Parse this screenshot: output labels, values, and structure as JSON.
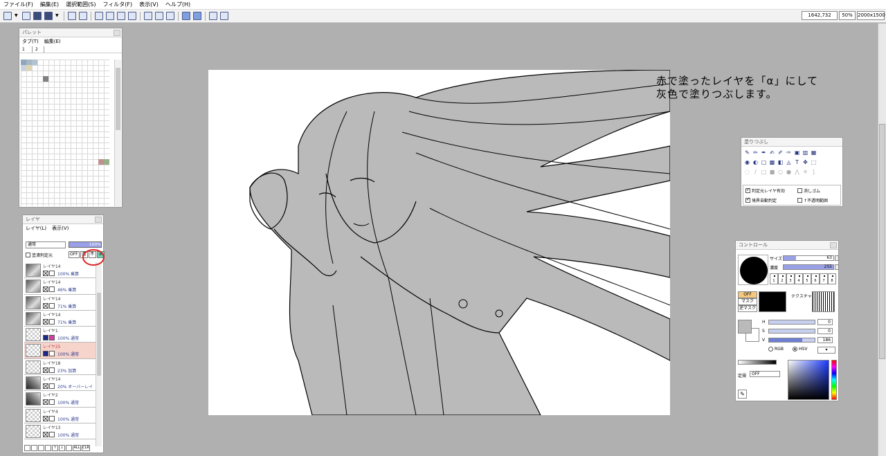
{
  "menu": [
    "ファイル(F)",
    "編集(E)",
    "選択範囲(S)",
    "フィルタ(F)",
    "表示(V)",
    "ヘルプ(H)"
  ],
  "toolbar": {
    "coords": "1642,732",
    "zoom": "50%",
    "canvas_size": "2000x1500"
  },
  "palette": {
    "title": "パレット",
    "menu": [
      "タブ(T)",
      "編集(E)"
    ],
    "tabs": [
      "1",
      "2"
    ],
    "swatches": [
      {
        "col": 0,
        "row": 0,
        "color": "#8fa6bf"
      },
      {
        "col": 1,
        "row": 0,
        "color": "#a7b8c4"
      },
      {
        "col": 2,
        "row": 0,
        "color": "#b3c2cc"
      },
      {
        "col": 0,
        "row": 1,
        "color": "#c9d3dc"
      },
      {
        "col": 1,
        "row": 1,
        "color": "#e0d5b3"
      },
      {
        "col": 4,
        "row": 3,
        "color": "#808080"
      },
      {
        "col": 14,
        "row": 18,
        "color": "#c09090"
      },
      {
        "col": 15,
        "row": 18,
        "color": "#98b08a"
      }
    ]
  },
  "layer": {
    "title": "レイヤ",
    "menu": [
      "レイヤ(L)",
      "表示(V)"
    ],
    "blend": "通常",
    "opacity": "100%",
    "clip_label": "塗潰判定元",
    "buttons": [
      "OFF",
      "透",
      "不",
      "α"
    ],
    "rows": [
      {
        "name": "レイヤ14",
        "mode": "100% 乗算",
        "thumb": "art",
        "selected": false
      },
      {
        "name": "レイヤ14",
        "mode": "46% 乗算",
        "thumb": "art",
        "selected": false
      },
      {
        "name": "レイヤ14",
        "mode": "71% 乗算",
        "thumb": "art",
        "selected": false
      },
      {
        "name": "レイヤ14",
        "mode": "71% 乗算",
        "thumb": "art",
        "selected": false
      },
      {
        "name": "レイヤ1",
        "mode": "100% 通常",
        "thumb": "check",
        "selected": false
      },
      {
        "name": "レイヤ25",
        "mode": "100% 通常",
        "thumb": "check",
        "selected": true
      },
      {
        "name": "レイヤ18",
        "mode": "23% 加算",
        "thumb": "check",
        "selected": false
      },
      {
        "name": "レイヤ14",
        "mode": "20% オーバーレイ",
        "thumb": "art2",
        "selected": false
      },
      {
        "name": "レイヤ2",
        "mode": "100% 通常",
        "thumb": "art2",
        "selected": false
      },
      {
        "name": "レイヤ4",
        "mode": "100% 通常",
        "thumb": "check",
        "selected": false
      },
      {
        "name": "レイヤ13",
        "mode": "100% 通常",
        "thumb": "check",
        "selected": false
      }
    ],
    "footer": [
      "ALL",
      "CLR"
    ]
  },
  "annotation": {
    "line1": "赤で塗ったレイヤを「α」にして",
    "line2": "灰色で塗りつぶします。"
  },
  "fill_panel": {
    "title": "塗りつぶし",
    "opt_reference": "判定元レイヤ有効",
    "opt_edge": "境界自動判定",
    "opt_erase": "消しゴム",
    "opt_opaque": "↑不透明範囲"
  },
  "control_panel": {
    "title": "コントロール",
    "size_label": "サイズ",
    "size_value": "63",
    "size_fraction": 0.25,
    "density_label": "濃度",
    "density_value": "255",
    "density_fraction": 1.0,
    "presets": [
      "1",
      "2",
      "3",
      "4",
      "5",
      "6",
      "7",
      "8"
    ],
    "mask_off": "OFF",
    "mask": "マスク",
    "inv_mask": "逆マスク",
    "texture_label": "テクスチャ",
    "h_label": "H",
    "h_value": "0",
    "s_label": "S",
    "s_value": "0",
    "v_label": "V",
    "v_value": "186",
    "v_fraction": 0.73,
    "rgb_label": "RGB",
    "hsv_label": "HSV",
    "ruler_label": "定規",
    "ruler_value": "OFF",
    "fg_color": "#bababa",
    "bg_color": "#ffffff"
  },
  "colors": {
    "accent": "#9aa0e8",
    "alpha_button": "#6fd5b7",
    "highlight_circle": "#e02020",
    "selected_layer": "#f6d4cc",
    "fill_gray": "#bababa"
  }
}
